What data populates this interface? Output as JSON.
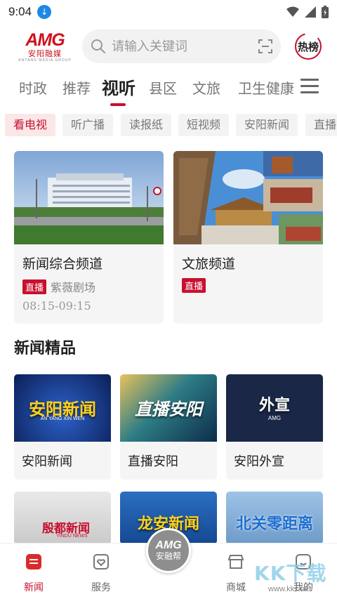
{
  "status_bar": {
    "time": "9:04",
    "download_icon": "download-icon",
    "wifi_icon": "wifi-icon",
    "signal_icon": "signal-icon",
    "battery_icon": "battery-icon"
  },
  "header": {
    "logo": {
      "brand": "AMG",
      "name": "安阳融媒",
      "tagline": "ANYANG MEDIA GROUP"
    },
    "search": {
      "placeholder": "请输入关键词",
      "icon": "search-icon",
      "scan_icon": "scan-icon"
    },
    "hot_label": "热榜"
  },
  "tabs": [
    "时政",
    "推荐",
    "视听",
    "县区",
    "文旅",
    "卫生健康"
  ],
  "active_tab": "视听",
  "sub_tabs": [
    "看电视",
    "听广播",
    "读报纸",
    "短视频",
    "安阳新闻",
    "直播"
  ],
  "active_sub_tab": "看电视",
  "live_channels": [
    {
      "title": "新闻综合频道",
      "badge": "直播",
      "program": "紫薇剧场",
      "time": "08:15-09:15"
    },
    {
      "title": "文旅频道",
      "badge": "直播",
      "program": "",
      "time": ""
    }
  ],
  "section_title": "新闻精品",
  "programs": [
    {
      "name": "安阳新闻",
      "thumb_text": "安阳新闻",
      "thumb_sub": "AN YANG XIN WEN"
    },
    {
      "name": "直播安阳",
      "thumb_text": "直播安阳",
      "thumb_sub": ""
    },
    {
      "name": "安阳外宣",
      "thumb_text": "外宣",
      "thumb_sub": "AMG"
    },
    {
      "name": "",
      "thumb_text": "殷都新闻",
      "thumb_sub": "YINDU NEWS"
    },
    {
      "name": "",
      "thumb_text": "龙安新闻",
      "thumb_sub": ""
    },
    {
      "name": "",
      "thumb_text": "北关零距离",
      "thumb_sub": ""
    }
  ],
  "bottom_nav": [
    {
      "label": "新闻",
      "icon": "news-icon"
    },
    {
      "label": "服务",
      "icon": "service-icon"
    },
    {
      "label": "商城",
      "icon": "shop-icon"
    },
    {
      "label": "我的",
      "icon": "profile-icon"
    }
  ],
  "center_button": {
    "line1": "AMG",
    "line2": "安融帮"
  },
  "watermark": {
    "text": "KK下载",
    "url": "www.kkx.net"
  },
  "colors": {
    "accent": "#c8102e",
    "chip_bg": "#f3f3f3",
    "card_bg": "#f5f5f5"
  }
}
